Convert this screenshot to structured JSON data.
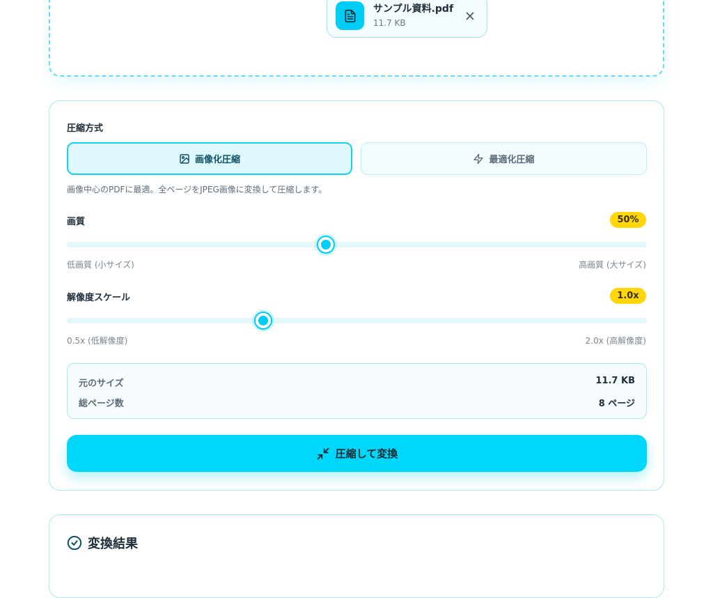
{
  "file": {
    "name": "サンプル資料.pdf",
    "size": "11.7 KB"
  },
  "compression": {
    "section_label": "圧縮方式",
    "methods": [
      {
        "label": "画像化圧縮",
        "icon": "image-icon",
        "selected": true
      },
      {
        "label": "最適化圧縮",
        "icon": "bolt-icon",
        "selected": false
      }
    ],
    "description": "画像中心のPDFに最適。全ページをJPEG画像に変換して圧縮します。"
  },
  "quality": {
    "label": "画質",
    "badge": "50%",
    "value_fraction": 0.447,
    "min_label": "低画質 (小サイズ)",
    "max_label": "高画質 (大サイズ)"
  },
  "scale": {
    "label": "解像度スケール",
    "badge": "1.0x",
    "value_fraction": 0.338,
    "min_label": "0.5x (低解像度)",
    "max_label": "2.0x (高解像度)"
  },
  "info": {
    "original_size_label": "元のサイズ",
    "original_size_value": "11.7 KB",
    "pages_label": "総ページ数",
    "pages_value": "8 ページ"
  },
  "convert_button": {
    "label": "圧縮して変換",
    "icon": "compress-icon"
  },
  "result": {
    "title": "変換結果",
    "icon": "check-circle-icon"
  },
  "colors": {
    "accent": "#00cdf5",
    "badge": "#ffd60a",
    "border": "#a9e9f7",
    "dropzone_border": "#67d9f2"
  }
}
